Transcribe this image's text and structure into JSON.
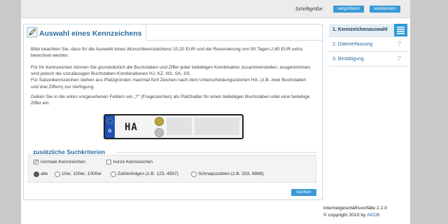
{
  "header": {
    "font_size_label": "Schriftgröße:",
    "enlarge_label": "vergrößern",
    "shrink_label": "verkleinern"
  },
  "main": {
    "title": "Auswahl eines Kennzeichens",
    "paragraph1": "Bitte beachten Sie, dass für die Auswahl eines Wunschkennzeichens 10,20 EUR und die Reservierung von 90 Tagen 2,60 EUR extra berechnet werden.",
    "paragraph2a": "Für Ihr Kennzeichen können Sie grundsätzlich die Buchstaben und Ziffer jeder beliebigen Kombination zusammenstellen, ausgenommen sind jedoch die unzulässigen Buchstaben-Kombinationen HJ, KZ, NS, SA, SS.",
    "paragraph2b": "Für Saisonkennzeichen stehen aus Platzgründen maximal fünf Zeichen nach dem Unterscheidungszeichen HA- (z.B. zwei Buchstaben und drei Ziffern) zur Verfügung.",
    "paragraph3": "Geben Sie in die unten vorgesehenen Feldern ein „?\" (Fragezeichen) als Platzhalter für einen beliebigen Buchstaben oder eine beliebige Ziffer ein.",
    "plate": {
      "country_code": "D",
      "district": "HA",
      "field1_value": "",
      "field2_value": ""
    }
  },
  "criteria": {
    "title": "zusätzliche Suchkriterien",
    "checkbox_normal": "normale Kennzeichen",
    "checkbox_short": "kurze Kennzeichen",
    "radio_all": "alle",
    "radio_round": "10er, 100er, 1000er",
    "radio_sequence": "Zahlenfolgen (z.B. 123, 4567)",
    "radio_snaps": "Schnapszahlen (z.B. 333, 8888)",
    "search_label": "suchen"
  },
  "sidebar": {
    "items": [
      {
        "label": "1. Kennzeichenauswahl"
      },
      {
        "label": "2. Datenerfassung"
      },
      {
        "label": "3. Bestätigung"
      }
    ]
  },
  "footer": {
    "line1": "Internetgeschäftsvorfälle 2.2.0",
    "line2_prefix": "© copyright 2010 by ",
    "line2_link": "AKDB"
  },
  "colors": {
    "accent": "#2c9bd6",
    "title": "#2a6aa0",
    "button": "#3a9ad9"
  }
}
